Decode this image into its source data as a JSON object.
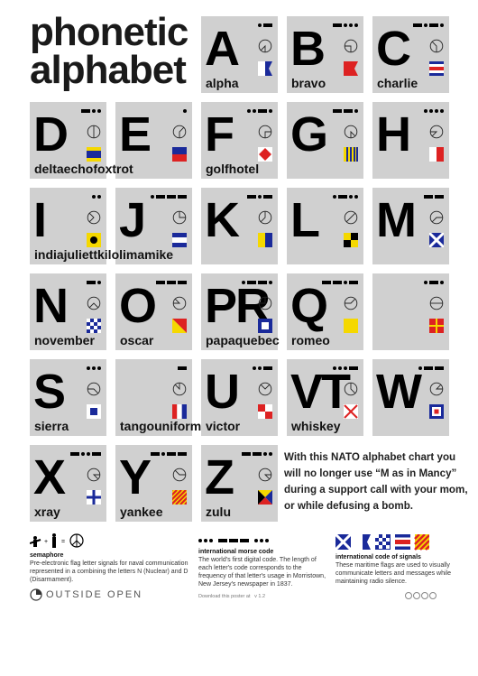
{
  "title": {
    "line1": "phonetic",
    "line2": "alphabet"
  },
  "tiles": [
    {
      "letter": "A",
      "word": "alpha",
      "morse": ".-",
      "flag": "alpha-flag"
    },
    {
      "letter": "B",
      "word": "bravo",
      "morse": "-...",
      "flag": "bravo-flag"
    },
    {
      "letter": "C",
      "word": "charlie",
      "morse": "-.-.",
      "flag": "charlie-flag"
    },
    {
      "letter": "D",
      "word": "deltaechofoxtrot",
      "morse": "-..",
      "flag": "delta-flag"
    },
    {
      "letter": "E",
      "word": "",
      "morse": ".",
      "flag": "echo-flag"
    },
    {
      "letter": "F",
      "word": "golfhotel",
      "morse": "..-.",
      "flag": "foxtrot-flag"
    },
    {
      "letter": "G",
      "word": "",
      "morse": "--.",
      "flag": "golf-flag"
    },
    {
      "letter": "H",
      "word": "",
      "morse": "....",
      "flag": "hotel-flag"
    },
    {
      "letter": "I",
      "word": "indiajuliettkilolimamike",
      "morse": "..",
      "flag": "india-flag"
    },
    {
      "letter": "J",
      "word": "",
      "morse": ".---",
      "flag": "juliett-flag"
    },
    {
      "letter": "K",
      "word": "",
      "morse": "-.-",
      "flag": "kilo-flag"
    },
    {
      "letter": "L",
      "word": "",
      "morse": ".-..",
      "flag": "lima-flag"
    },
    {
      "letter": "M",
      "word": "",
      "morse": "--",
      "flag": "mike-flag"
    },
    {
      "letter": "N",
      "word": "november",
      "morse": "-.",
      "flag": "november-flag"
    },
    {
      "letter": "O",
      "word": "oscar",
      "morse": "---",
      "flag": "oscar-flag"
    },
    {
      "letter": "PR",
      "word": "papaquebec",
      "morse": ".--.",
      "flag": "papa-flag"
    },
    {
      "letter": "Q",
      "word": "romeo",
      "morse": "--.-",
      "flag": "quebec-flag"
    },
    {
      "letter": "",
      "word": "",
      "morse": ".-.",
      "flag": "romeo-flag"
    },
    {
      "letter": "S",
      "word": "sierra",
      "morse": "...",
      "flag": "sierra-flag"
    },
    {
      "letter": "",
      "word": "tangouniform",
      "morse": "-",
      "flag": "tango-flag"
    },
    {
      "letter": "U",
      "word": "victor",
      "morse": "..-",
      "flag": "uniform-flag"
    },
    {
      "letter": "VT",
      "word": "whiskey",
      "morse": "...-",
      "flag": "victor-flag"
    },
    {
      "letter": "W",
      "word": "",
      "morse": ".--",
      "flag": "whiskey-flag"
    },
    {
      "letter": "X",
      "word": "xray",
      "morse": "-..-",
      "flag": "xray-flag"
    },
    {
      "letter": "Y",
      "word": "yankee",
      "morse": "-.--",
      "flag": "yankee-flag"
    },
    {
      "letter": "Z",
      "word": "zulu",
      "morse": "--..",
      "flag": "zulu-flag"
    }
  ],
  "intro": "With this NATO alphabet chart you will no longer use “M as in Mancy” during a support call with your mom, or while defusing a bomb.",
  "footer": {
    "semaphore": {
      "heading": "semaphore",
      "text": "Pre-electronic flag letter signals for naval communication represented in a combining the letters N (Nuclear) and D (Disarmament)."
    },
    "morse": {
      "heading": "international morse code",
      "text": "The world's first digital code.  The length of each letter's code corresponds to the frequency of that letter's usage in Morristown, New Jersey's newspaper in 1837."
    },
    "signals": {
      "heading": "international code of signals",
      "text": "These maritime flags are used to visually communicate letters and messages while maintaining radio silence."
    },
    "brand": "OUTSIDE OPEN",
    "download": "Download this poster at",
    "version": "v 1.2"
  }
}
